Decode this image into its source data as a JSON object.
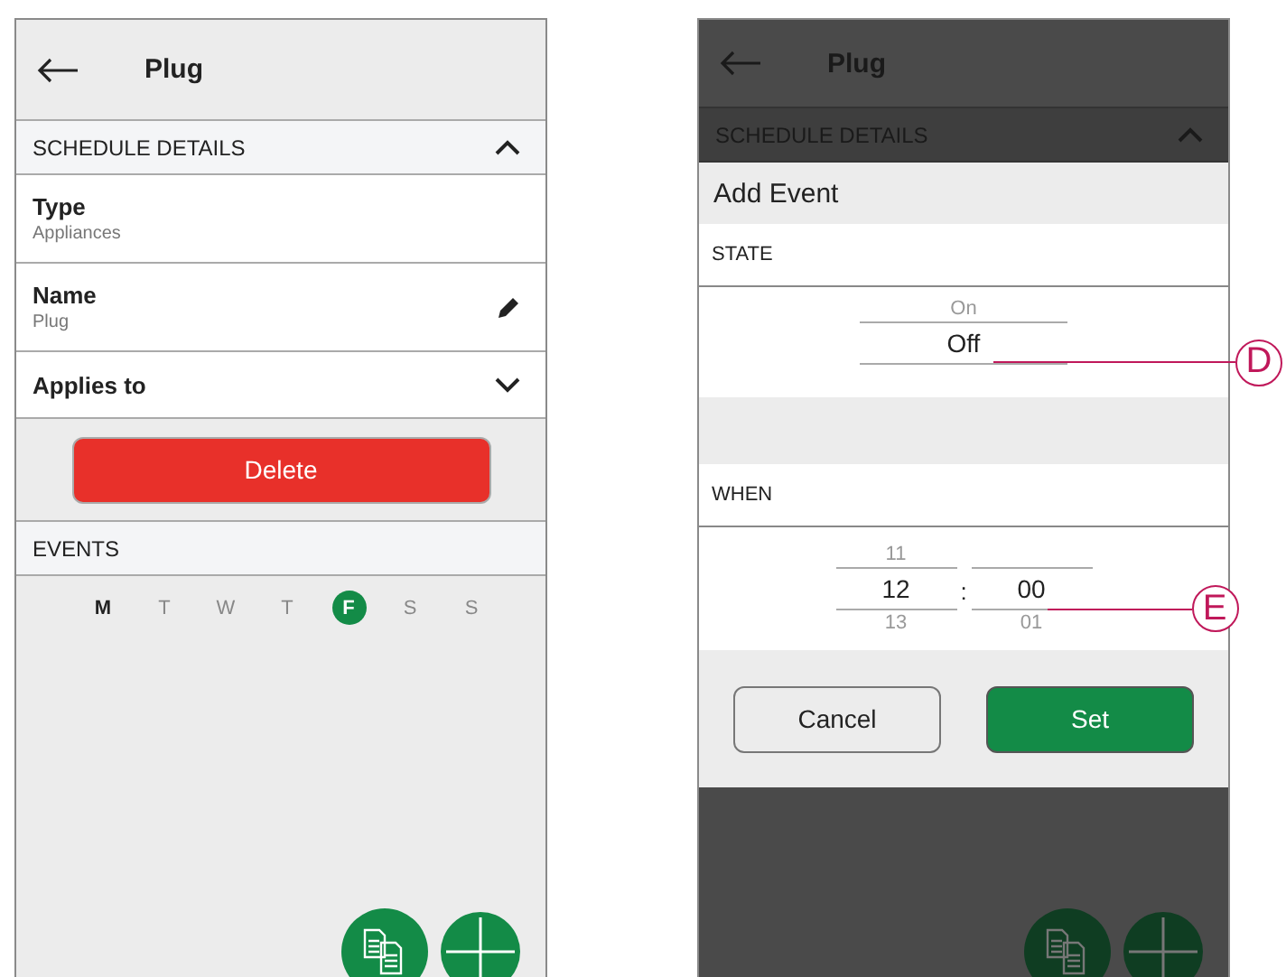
{
  "schedule_screen": {
    "header": {
      "title": "Plug"
    },
    "section": {
      "title": "SCHEDULE DETAILS",
      "expanded": true
    },
    "fields": [
      {
        "kind": "info",
        "label": "Type",
        "value": "Appliances"
      },
      {
        "kind": "editable",
        "label": "Name",
        "value": "Plug"
      },
      {
        "kind": "dropdown",
        "label": "Applies to",
        "expanded": false
      }
    ],
    "delete_button": "Delete",
    "events_title": "EVENTS",
    "days": [
      {
        "label": "M",
        "today": true,
        "selected": false
      },
      {
        "label": "T",
        "today": false,
        "selected": false
      },
      {
        "label": "W",
        "today": false,
        "selected": false
      },
      {
        "label": "T",
        "today": false,
        "selected": false
      },
      {
        "label": "F",
        "today": false,
        "selected": true
      },
      {
        "label": "S",
        "today": false,
        "selected": false
      },
      {
        "label": "S",
        "today": false,
        "selected": false
      }
    ]
  },
  "add_event_screen": {
    "header": {
      "title": "Plug"
    },
    "section": {
      "title": "SCHEDULE DETAILS",
      "expanded": true
    },
    "dialog": {
      "title": "Add Event",
      "state_label": "STATE",
      "state_picker": {
        "above": "On",
        "value": "Off",
        "callout": "D"
      },
      "when_label": "WHEN",
      "time_picker": {
        "hour": {
          "above": "11",
          "value": "12",
          "below": "13"
        },
        "separator": ":",
        "minute": {
          "value": "00",
          "below": "01"
        },
        "callout": "E"
      },
      "buttons": [
        {
          "label": "Cancel",
          "kind": "secondary"
        },
        {
          "label": "Set",
          "kind": "primary"
        }
      ]
    }
  }
}
